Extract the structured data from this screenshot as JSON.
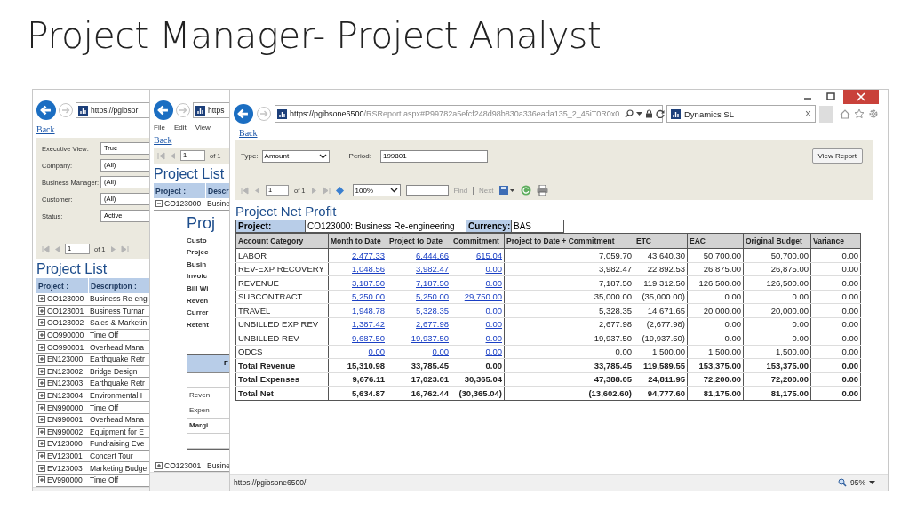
{
  "slide": {
    "title": "Project Manager- Project Analyst"
  },
  "back_window": {
    "address": "https://pgibsor",
    "back_link": "Back",
    "filters": [
      {
        "label": "Executive View:",
        "value": "True"
      },
      {
        "label": "Company:",
        "value": "(All)"
      },
      {
        "label": "Business Manager:",
        "value": "(All)"
      },
      {
        "label": "Customer:",
        "value": "(All)"
      },
      {
        "label": "Status:",
        "value": "Active"
      }
    ],
    "pager": {
      "page": "1",
      "of": "of 1"
    },
    "report_title": "Project List",
    "columns": [
      "Project :",
      "Description :"
    ],
    "rows": [
      {
        "expanded": false,
        "project": "CO123000",
        "description": "Business Re-eng"
      },
      {
        "expanded": false,
        "project": "CO123001",
        "description": "Business Turnar"
      },
      {
        "expanded": false,
        "project": "CO123002",
        "description": "Sales & Marketin"
      },
      {
        "expanded": false,
        "project": "CO990000",
        "description": "Time Off"
      },
      {
        "expanded": false,
        "project": "CO990001",
        "description": "Overhead Mana"
      },
      {
        "expanded": false,
        "project": "EN123000",
        "description": "Earthquake Retr"
      },
      {
        "expanded": false,
        "project": "EN123002",
        "description": "Bridge Design"
      },
      {
        "expanded": false,
        "project": "EN123003",
        "description": "Earthquake Retr"
      },
      {
        "expanded": false,
        "project": "EN123004",
        "description": "Environmental I"
      },
      {
        "expanded": false,
        "project": "EN990000",
        "description": "Time Off"
      },
      {
        "expanded": false,
        "project": "EN990001",
        "description": "Overhead Mana"
      },
      {
        "expanded": false,
        "project": "EN990002",
        "description": "Equipment for E"
      },
      {
        "expanded": false,
        "project": "EV123000",
        "description": "Fundraising Eve"
      },
      {
        "expanded": false,
        "project": "EV123001",
        "description": "Concert Tour"
      },
      {
        "expanded": false,
        "project": "EV123003",
        "description": "Marketing Budge"
      },
      {
        "expanded": false,
        "project": "EV990000",
        "description": "Time Off"
      }
    ]
  },
  "middle_window": {
    "address": "https",
    "menu": [
      "File",
      "Edit",
      "View"
    ],
    "back_link": "Back",
    "pager": {
      "page": "1",
      "of": "of 1"
    },
    "report_title": "Project List",
    "columns": [
      "Project :",
      "Descr"
    ],
    "rows": [
      {
        "expanded": true,
        "project": "CO123000",
        "description": "Busine",
        "detail": {
          "heading": "Proj",
          "fields": [
            "Custo",
            "Projec",
            "Busin",
            "Invoic",
            "Bill Wi",
            "Reven",
            "Currer",
            "Retent"
          ],
          "summary": {
            "header": "F",
            "rows": [
              {
                "label": "Reven",
                "bold": false
              },
              {
                "label": "Expen",
                "bold": false
              },
              {
                "label": "Margi",
                "bold": true
              }
            ]
          }
        }
      },
      {
        "expanded": false,
        "project": "CO123001",
        "description": "Busine"
      }
    ]
  },
  "front_window": {
    "address": {
      "host": "https://pgibsone6500",
      "path": "/RSReport.aspx#P99782a5efcf248d98b830a336eada135_2_45iT0R0x0"
    },
    "tab": {
      "title": "Dynamics SL",
      "close": "×"
    },
    "back_link": "Back",
    "parameters": {
      "type_label": "Type:",
      "type_value": "Amount",
      "period_label": "Period:",
      "period_value": "199801",
      "button": "View Report"
    },
    "toolbar": {
      "page": "1",
      "of": "of 1",
      "zoom": "100%",
      "find": "Find",
      "next": "Next"
    },
    "report_title": "Project Net Profit",
    "header": {
      "project_label": "Project:",
      "project_value": "CO123000: Business Re-engineering",
      "currency_label": "Currency:",
      "currency_value": "BAS"
    },
    "columns": [
      "Account Category",
      "Month to Date",
      "Project to Date",
      "Commitment",
      "Project to Date + Commitment",
      "ETC",
      "EAC",
      "Original Budget",
      "Variance"
    ],
    "rows": [
      {
        "kind": "detail",
        "category": "LABOR",
        "values": [
          "2,477.33",
          "6,444.66",
          "615.04",
          "7,059.70",
          "43,640.30",
          "50,700.00",
          "50,700.00",
          "0.00"
        ]
      },
      {
        "kind": "detail",
        "category": "REV-EXP RECOVERY",
        "values": [
          "1,048.56",
          "3,982.47",
          "0.00",
          "3,982.47",
          "22,892.53",
          "26,875.00",
          "26,875.00",
          "0.00"
        ]
      },
      {
        "kind": "detail",
        "category": "REVENUE",
        "values": [
          "3,187.50",
          "7,187.50",
          "0.00",
          "7,187.50",
          "119,312.50",
          "126,500.00",
          "126,500.00",
          "0.00"
        ]
      },
      {
        "kind": "detail",
        "category": "SUBCONTRACT",
        "values": [
          "5,250.00",
          "5,250.00",
          "29,750.00",
          "35,000.00",
          "(35,000.00)",
          "0.00",
          "0.00",
          "0.00"
        ]
      },
      {
        "kind": "detail",
        "category": "TRAVEL",
        "values": [
          "1,948.78",
          "5,328.35",
          "0.00",
          "5,328.35",
          "14,671.65",
          "20,000.00",
          "20,000.00",
          "0.00"
        ]
      },
      {
        "kind": "detail",
        "category": "UNBILLED EXP REV",
        "values": [
          "1,387.42",
          "2,677.98",
          "0.00",
          "2,677.98",
          "(2,677.98)",
          "0.00",
          "0.00",
          "0.00"
        ]
      },
      {
        "kind": "detail",
        "category": "UNBILLED REV",
        "values": [
          "9,687.50",
          "19,937.50",
          "0.00",
          "19,937.50",
          "(19,937.50)",
          "0.00",
          "0.00",
          "0.00"
        ]
      },
      {
        "kind": "detail",
        "category": "ODCS",
        "values": [
          "0.00",
          "0.00",
          "0.00",
          "0.00",
          "1,500.00",
          "1,500.00",
          "1,500.00",
          "0.00"
        ]
      },
      {
        "kind": "total",
        "category": "Total Revenue",
        "values": [
          "15,310.98",
          "33,785.45",
          "0.00",
          "33,785.45",
          "119,589.55",
          "153,375.00",
          "153,375.00",
          "0.00"
        ]
      },
      {
        "kind": "total",
        "category": "Total Expenses",
        "values": [
          "9,676.11",
          "17,023.01",
          "30,365.04",
          "47,388.05",
          "24,811.95",
          "72,200.00",
          "72,200.00",
          "0.00"
        ]
      },
      {
        "kind": "total",
        "category": "Total Net",
        "values": [
          "5,634.87",
          "16,762.44",
          "(30,365.04)",
          "(13,602.60)",
          "94,777.60",
          "81,175.00",
          "81,175.00",
          "0.00"
        ]
      }
    ],
    "status_bar": {
      "url": "https://pgibsone6500/",
      "zoom": "95%"
    }
  }
}
